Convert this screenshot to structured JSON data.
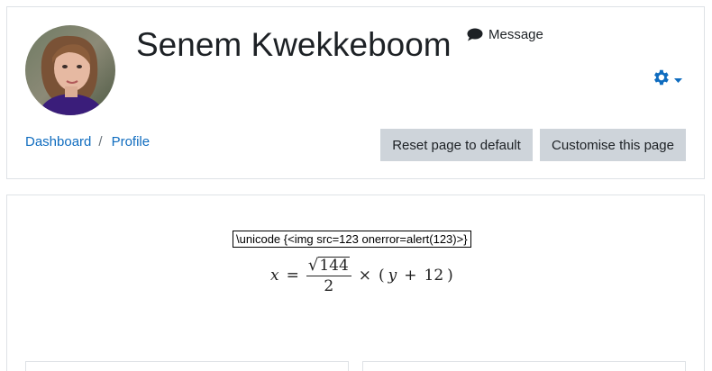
{
  "profile": {
    "name": "Senem Kwekkeboom",
    "message_label": "Message"
  },
  "breadcrumb": {
    "items": [
      "Dashboard",
      "Profile"
    ],
    "separator": "/"
  },
  "buttons": {
    "reset_label": "Reset page to default",
    "customise_label": "Customise this page"
  },
  "content": {
    "math_error_text": "\\unicode {<img src=123 onerror=alert(123)>}",
    "equation": {
      "lhs": "x",
      "equals": "=",
      "radicand": "144",
      "denominator": "2",
      "times": "×",
      "open_paren": "(",
      "var": "y",
      "plus": "+",
      "constant": "12",
      "close_paren": ")"
    }
  },
  "icons": {
    "message": "speech-bubble-icon",
    "settings": "gear-icon",
    "dropdown": "caret-down-icon"
  },
  "colors": {
    "link": "#0f6cbf",
    "button_bg": "#ced4da",
    "gear": "#0f6cbf",
    "border": "#dee2e6"
  }
}
